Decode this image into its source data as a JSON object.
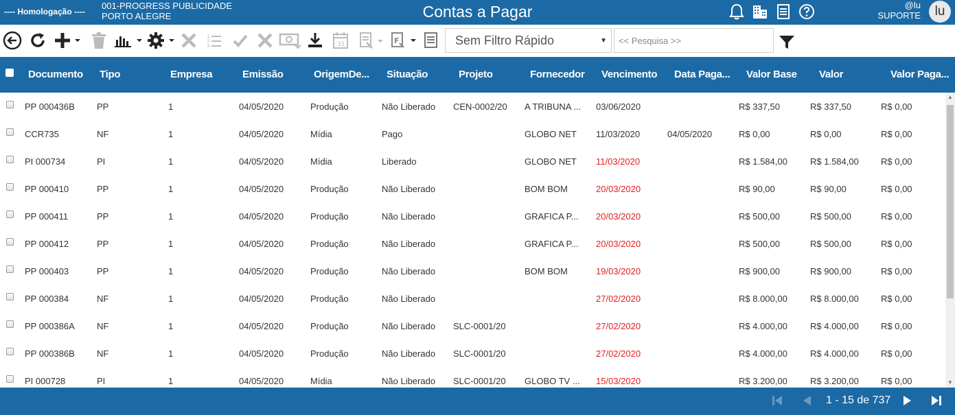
{
  "header": {
    "environment": "---- Homologação ----",
    "company_line1": "001-PROGRESS PUBLICIDADE",
    "company_line2": "PORTO ALEGRE",
    "title": "Contas a Pagar",
    "user_handle": "@lu",
    "user_role": "SUPORTE",
    "avatar_initials": "lu",
    "icons": [
      "bell-icon",
      "building-icon",
      "document-icon",
      "help-icon"
    ]
  },
  "toolbar": {
    "icons": [
      "back-icon",
      "refresh-icon",
      "add-icon",
      "trash-icon",
      "chart-icon",
      "gear-icon",
      "cancel-icon",
      "list-numbers-icon",
      "check-icon",
      "close-icon",
      "money-icon",
      "download-icon",
      "calendar-icon",
      "document-dropdown-icon",
      "report-icon",
      "notes-icon"
    ],
    "quick_filter": "Sem Filtro Rápido",
    "search_placeholder": "<< Pesquisa >>"
  },
  "table": {
    "columns": [
      "Documento",
      "Tipo",
      "Empresa",
      "Emissão",
      "OrigemDe...",
      "Situação",
      "Projeto",
      "Fornecedor",
      "Vencimento",
      "Data Paga...",
      "Valor Base",
      "Valor",
      "Valor Paga..."
    ],
    "rows": [
      {
        "doc": "PP 000436B",
        "tipo": "PP",
        "empresa": "1",
        "emissao": "04/05/2020",
        "origem": "Produção",
        "situacao": "Não Liberado",
        "projeto": "CEN-0002/20",
        "fornecedor": "A TRIBUNA ...",
        "vencimento": "03/06/2020",
        "overdue": false,
        "data_pag": "",
        "valor_base": "R$ 337,50",
        "valor": "R$ 337,50",
        "valor_pago": "R$ 0,00"
      },
      {
        "doc": "CCR735",
        "tipo": "NF",
        "empresa": "1",
        "emissao": "04/05/2020",
        "origem": "Mídia",
        "situacao": "Pago",
        "projeto": "",
        "fornecedor": "GLOBO NET",
        "vencimento": "11/03/2020",
        "overdue": false,
        "data_pag": "04/05/2020",
        "valor_base": "R$ 0,00",
        "valor": "R$ 0,00",
        "valor_pago": "R$ 0,00"
      },
      {
        "doc": "PI 000734",
        "tipo": "PI",
        "empresa": "1",
        "emissao": "04/05/2020",
        "origem": "Mídia",
        "situacao": "Liberado",
        "projeto": "",
        "fornecedor": "GLOBO NET",
        "vencimento": "11/03/2020",
        "overdue": true,
        "data_pag": "",
        "valor_base": "R$ 1.584,00",
        "valor": "R$ 1.584,00",
        "valor_pago": "R$ 0,00"
      },
      {
        "doc": "PP 000410",
        "tipo": "PP",
        "empresa": "1",
        "emissao": "04/05/2020",
        "origem": "Produção",
        "situacao": "Não Liberado",
        "projeto": "",
        "fornecedor": "BOM BOM",
        "vencimento": "20/03/2020",
        "overdue": true,
        "data_pag": "",
        "valor_base": "R$ 90,00",
        "valor": "R$ 90,00",
        "valor_pago": "R$ 0,00"
      },
      {
        "doc": "PP 000411",
        "tipo": "PP",
        "empresa": "1",
        "emissao": "04/05/2020",
        "origem": "Produção",
        "situacao": "Não Liberado",
        "projeto": "",
        "fornecedor": "GRAFICA P...",
        "vencimento": "20/03/2020",
        "overdue": true,
        "data_pag": "",
        "valor_base": "R$ 500,00",
        "valor": "R$ 500,00",
        "valor_pago": "R$ 0,00"
      },
      {
        "doc": "PP 000412",
        "tipo": "PP",
        "empresa": "1",
        "emissao": "04/05/2020",
        "origem": "Produção",
        "situacao": "Não Liberado",
        "projeto": "",
        "fornecedor": "GRAFICA P...",
        "vencimento": "20/03/2020",
        "overdue": true,
        "data_pag": "",
        "valor_base": "R$ 500,00",
        "valor": "R$ 500,00",
        "valor_pago": "R$ 0,00"
      },
      {
        "doc": "PP 000403",
        "tipo": "PP",
        "empresa": "1",
        "emissao": "04/05/2020",
        "origem": "Produção",
        "situacao": "Não Liberado",
        "projeto": "",
        "fornecedor": "BOM BOM",
        "vencimento": "19/03/2020",
        "overdue": true,
        "data_pag": "",
        "valor_base": "R$ 900,00",
        "valor": "R$ 900,00",
        "valor_pago": "R$ 0,00"
      },
      {
        "doc": "PP 000384",
        "tipo": "NF",
        "empresa": "1",
        "emissao": "04/05/2020",
        "origem": "Produção",
        "situacao": "Não Liberado",
        "projeto": "",
        "fornecedor": "",
        "vencimento": "27/02/2020",
        "overdue": true,
        "data_pag": "",
        "valor_base": "R$ 8.000,00",
        "valor": "R$ 8.000,00",
        "valor_pago": "R$ 0,00"
      },
      {
        "doc": "PP 000386A",
        "tipo": "NF",
        "empresa": "1",
        "emissao": "04/05/2020",
        "origem": "Produção",
        "situacao": "Não Liberado",
        "projeto": "SLC-0001/20",
        "fornecedor": "",
        "vencimento": "27/02/2020",
        "overdue": true,
        "data_pag": "",
        "valor_base": "R$ 4.000,00",
        "valor": "R$ 4.000,00",
        "valor_pago": "R$ 0,00"
      },
      {
        "doc": "PP 000386B",
        "tipo": "NF",
        "empresa": "1",
        "emissao": "04/05/2020",
        "origem": "Produção",
        "situacao": "Não Liberado",
        "projeto": "SLC-0001/20",
        "fornecedor": "",
        "vencimento": "27/02/2020",
        "overdue": true,
        "data_pag": "",
        "valor_base": "R$ 4.000,00",
        "valor": "R$ 4.000,00",
        "valor_pago": "R$ 0,00"
      },
      {
        "doc": "PI 000728",
        "tipo": "PI",
        "empresa": "1",
        "emissao": "04/05/2020",
        "origem": "Mídia",
        "situacao": "Não Liberado",
        "projeto": "SLC-0001/20",
        "fornecedor": "GLOBO TV ...",
        "vencimento": "15/03/2020",
        "overdue": true,
        "data_pag": "",
        "valor_base": "R$ 3.200,00",
        "valor": "R$ 3.200,00",
        "valor_pago": "R$ 0,00"
      }
    ]
  },
  "pagination": {
    "label": "1 - 15 de 737"
  },
  "colors": {
    "brand": "#1b6aa5",
    "overdue": "#e02020"
  }
}
